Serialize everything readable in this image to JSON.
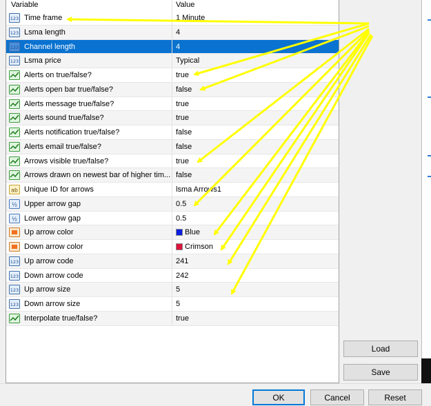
{
  "header": {
    "variable": "Variable",
    "value": "Value"
  },
  "rows": [
    {
      "name": "Time frame",
      "value": "1 Minute",
      "icon": "number-icon"
    },
    {
      "name": "Lsma length",
      "value": "4",
      "icon": "number-icon"
    },
    {
      "name": "Channel length",
      "value": "4",
      "icon": "number-icon",
      "selected": true
    },
    {
      "name": "Lsma price",
      "value": "Typical",
      "icon": "number-icon"
    },
    {
      "name": "Alerts on true/false?",
      "value": "true",
      "icon": "boolean-icon"
    },
    {
      "name": "Alerts open bar true/false?",
      "value": "false",
      "icon": "boolean-icon"
    },
    {
      "name": "Alerts message true/false?",
      "value": "true",
      "icon": "boolean-icon"
    },
    {
      "name": "Alerts sound true/false?",
      "value": "true",
      "icon": "boolean-icon"
    },
    {
      "name": "Alerts notification true/false?",
      "value": "false",
      "icon": "boolean-icon"
    },
    {
      "name": "Alerts email true/false?",
      "value": "false",
      "icon": "boolean-icon"
    },
    {
      "name": "Arrows visible true/false?",
      "value": "true",
      "icon": "boolean-icon"
    },
    {
      "name": "Arrows drawn on newest bar of higher tim...",
      "value": "false",
      "icon": "boolean-icon"
    },
    {
      "name": "Unique ID for arrows",
      "value": "lsma Arrows1",
      "icon": "string-icon"
    },
    {
      "name": "Upper arrow gap",
      "value": "0.5",
      "icon": "double-icon"
    },
    {
      "name": "Lower arrow gap",
      "value": "0.5",
      "icon": "double-icon"
    },
    {
      "name": "Up arrow color",
      "value": "Blue",
      "icon": "color-icon",
      "swatch": "#0a1ee0"
    },
    {
      "name": "Down arrow color",
      "value": "Crimson",
      "icon": "color-icon",
      "swatch": "#dc143c"
    },
    {
      "name": "Up arrow code",
      "value": "241",
      "icon": "number-icon"
    },
    {
      "name": "Down arrow code",
      "value": "242",
      "icon": "number-icon"
    },
    {
      "name": "Up arrow size",
      "value": "5",
      "icon": "number-icon"
    },
    {
      "name": "Down arrow size",
      "value": "5",
      "icon": "number-icon"
    },
    {
      "name": "Interpolate true/false?",
      "value": "true",
      "icon": "boolean-icon"
    }
  ],
  "buttons": {
    "load": "Load",
    "save": "Save",
    "ok": "OK",
    "cancel": "Cancel",
    "reset": "Reset"
  },
  "colors": {
    "selection": "#0a72d0",
    "annotation": "#ffff00"
  }
}
